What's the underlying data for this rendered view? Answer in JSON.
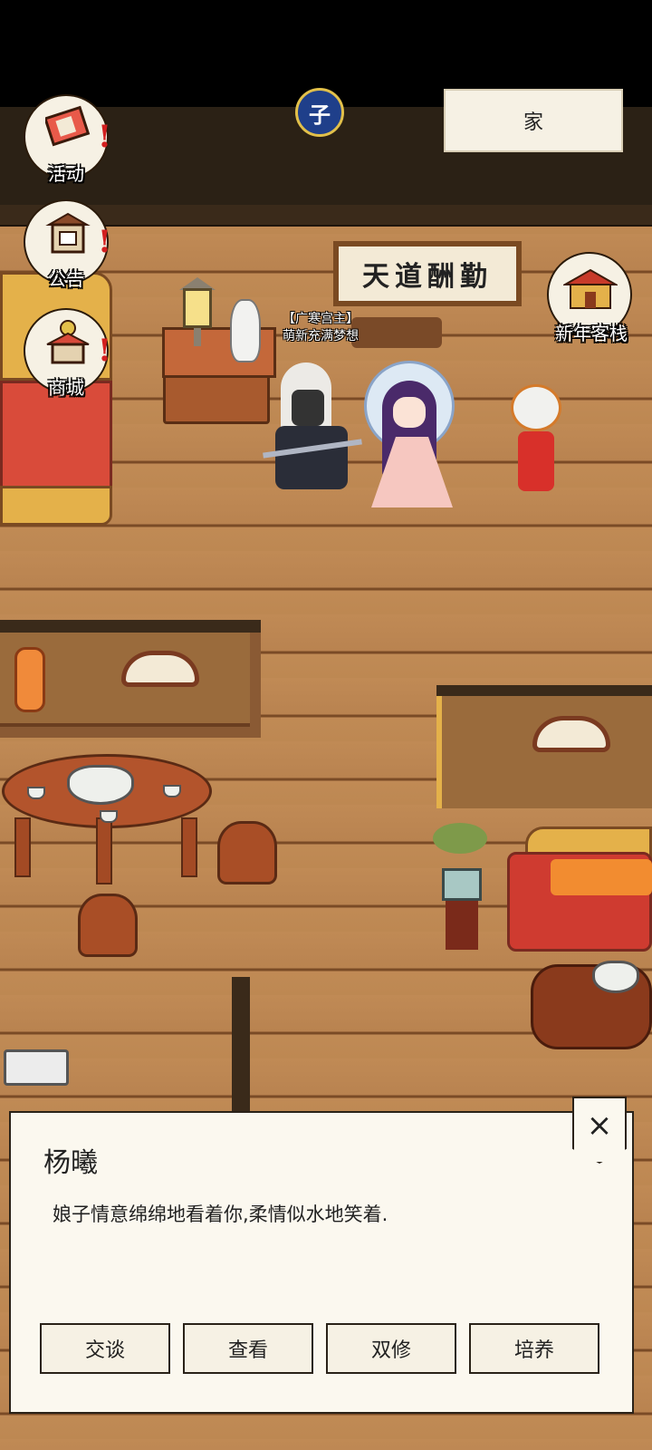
{
  "location": "家",
  "time_badge": "子",
  "plaque": "天道酬勤",
  "menu": {
    "activity": "活动",
    "notice": "公告",
    "shop": "商城",
    "inn": "新年客栈",
    "alert_mark": "!"
  },
  "player": {
    "title": "【广寒宫主】",
    "name": "萌新充满梦想"
  },
  "dialog": {
    "speaker": "杨曦",
    "text": "娘子情意绵绵地看着你,柔情似水地笑着.",
    "close": "×",
    "actions": [
      "交谈",
      "查看",
      "双修",
      "培养"
    ]
  },
  "colors": {
    "floor": "#c08a55",
    "panel": "#fbf8ef",
    "alert": "#d21f1f"
  }
}
